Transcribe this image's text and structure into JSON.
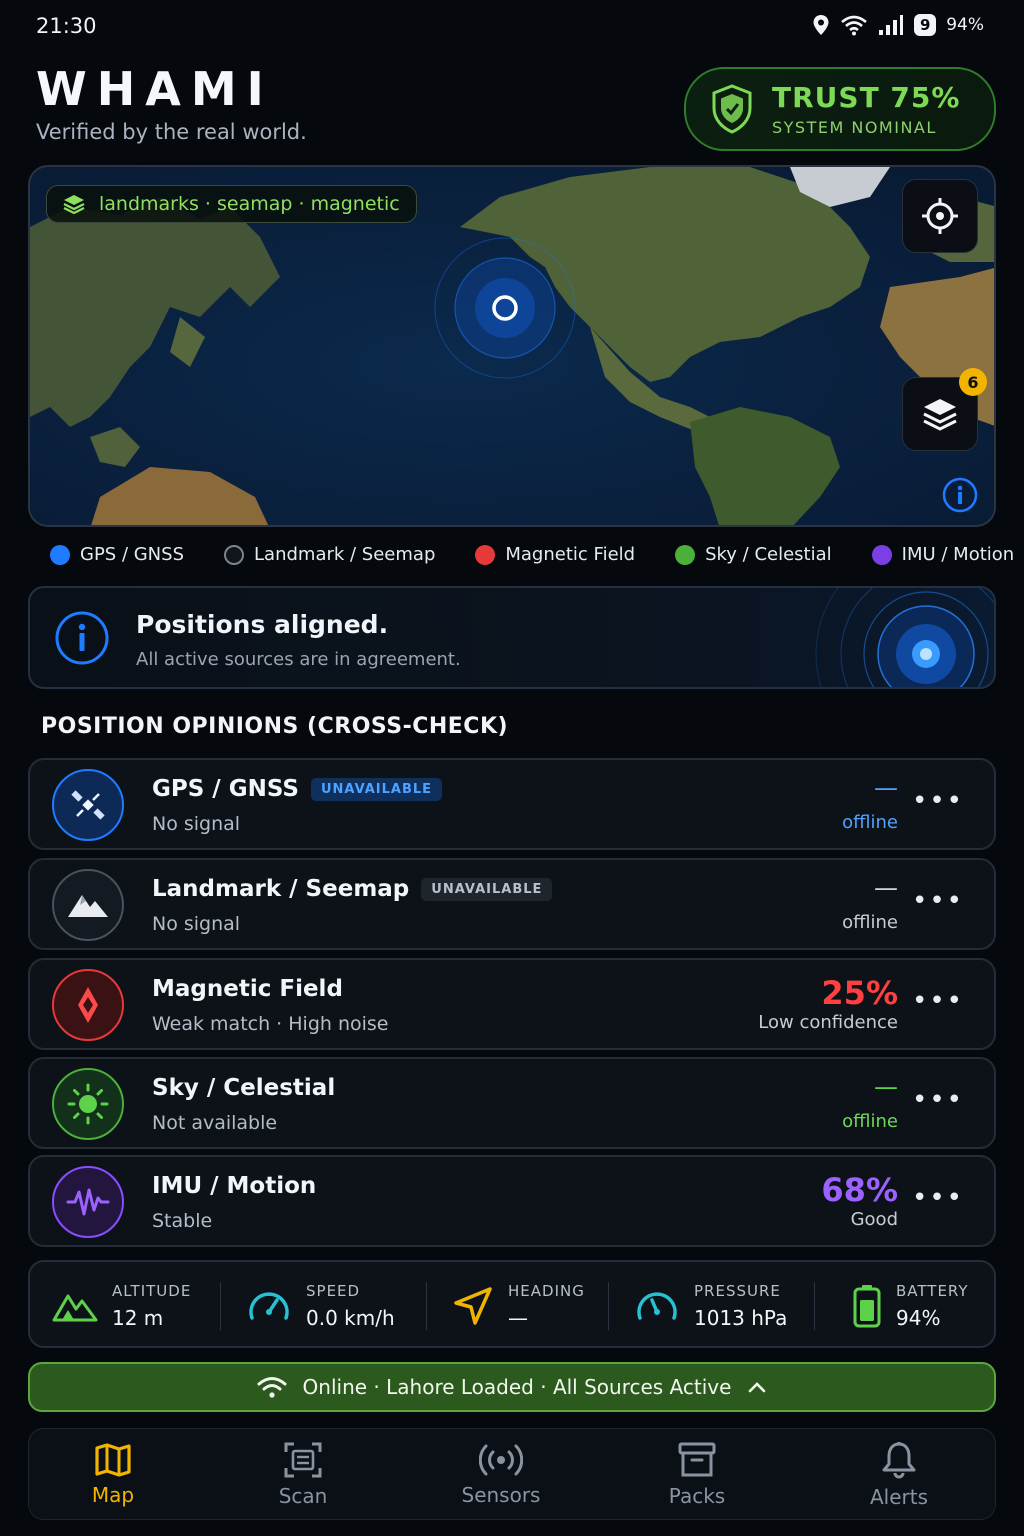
{
  "status_bar": {
    "time": "21:30",
    "notification_count": "9",
    "battery": "94%",
    "icons": [
      "location-icon",
      "wifi-icon",
      "signal-icon"
    ]
  },
  "header": {
    "title": "WHAMI",
    "tagline": "Verified by the real world."
  },
  "trust": {
    "title": "TRUST 75%",
    "status": "SYSTEM NOMINAL",
    "icon": "shield-icon",
    "color": "#7ed957"
  },
  "map": {
    "layers_label": "landmarks · seamap · magnetic",
    "layer_count": "6",
    "icons": [
      "layers-icon",
      "crosshair-icon",
      "info-icon"
    ]
  },
  "legend": [
    {
      "label": "GPS / GNSS",
      "color": "#1f7bff"
    },
    {
      "label": "Landmark / Seemap",
      "color": "#1a1f26"
    },
    {
      "label": "Magnetic Field",
      "color": "#e5393a"
    },
    {
      "label": "Sky / Celestial",
      "color": "#4caf3a"
    },
    {
      "label": "IMU / Motion",
      "color": "#7b3fe4"
    }
  ],
  "alignment": {
    "title": "Positions aligned.",
    "subtitle": "All active sources are in agreement."
  },
  "opinions": {
    "section_title": "POSITION OPINIONS (CROSS-CHECK)",
    "items": [
      {
        "name": "GPS / GNSS",
        "tag": "UNAVAILABLE",
        "sub": "No signal",
        "value": "—",
        "status": "offline",
        "accent": "#1f7bff",
        "icon": "satellite-icon"
      },
      {
        "name": "Landmark / Seemap",
        "tag": "UNAVAILABLE",
        "sub": "No signal",
        "value": "—",
        "status": "offline",
        "accent": "#9aa3ad",
        "icon": "mountain-icon"
      },
      {
        "name": "Magnetic Field",
        "tag": "",
        "sub": "Weak match · High noise",
        "value": "25%",
        "status": "Low confidence",
        "accent": "#e5393a",
        "icon": "compass-icon"
      },
      {
        "name": "Sky / Celestial",
        "tag": "",
        "sub": "Not available",
        "value": "—",
        "status": "offline",
        "accent": "#4caf3a",
        "icon": "sun-icon"
      },
      {
        "name": "IMU / Motion",
        "tag": "",
        "sub": "Stable",
        "value": "68%",
        "status": "Good",
        "accent": "#8a4dff",
        "icon": "waveform-icon"
      }
    ]
  },
  "metrics": [
    {
      "label": "ALTITUDE",
      "value": "12 m",
      "icon": "altitude-icon"
    },
    {
      "label": "SPEED",
      "value": "0.0 km/h",
      "icon": "speedometer-icon"
    },
    {
      "label": "HEADING",
      "value": "—",
      "icon": "navigation-arrow-icon"
    },
    {
      "label": "PRESSURE",
      "value": "1013 hPa",
      "icon": "gauge-icon"
    },
    {
      "label": "BATTERY",
      "value": "94%",
      "icon": "battery-icon"
    }
  ],
  "online_bar": {
    "text": "Online · Lahore Loaded · All Sources Active"
  },
  "nav": [
    {
      "label": "Map",
      "active": true,
      "icon": "map-icon"
    },
    {
      "label": "Scan",
      "active": false,
      "icon": "scan-icon"
    },
    {
      "label": "Sensors",
      "active": false,
      "icon": "broadcast-icon"
    },
    {
      "label": "Packs",
      "active": false,
      "icon": "archive-icon"
    },
    {
      "label": "Alerts",
      "active": false,
      "icon": "bell-icon"
    }
  ]
}
